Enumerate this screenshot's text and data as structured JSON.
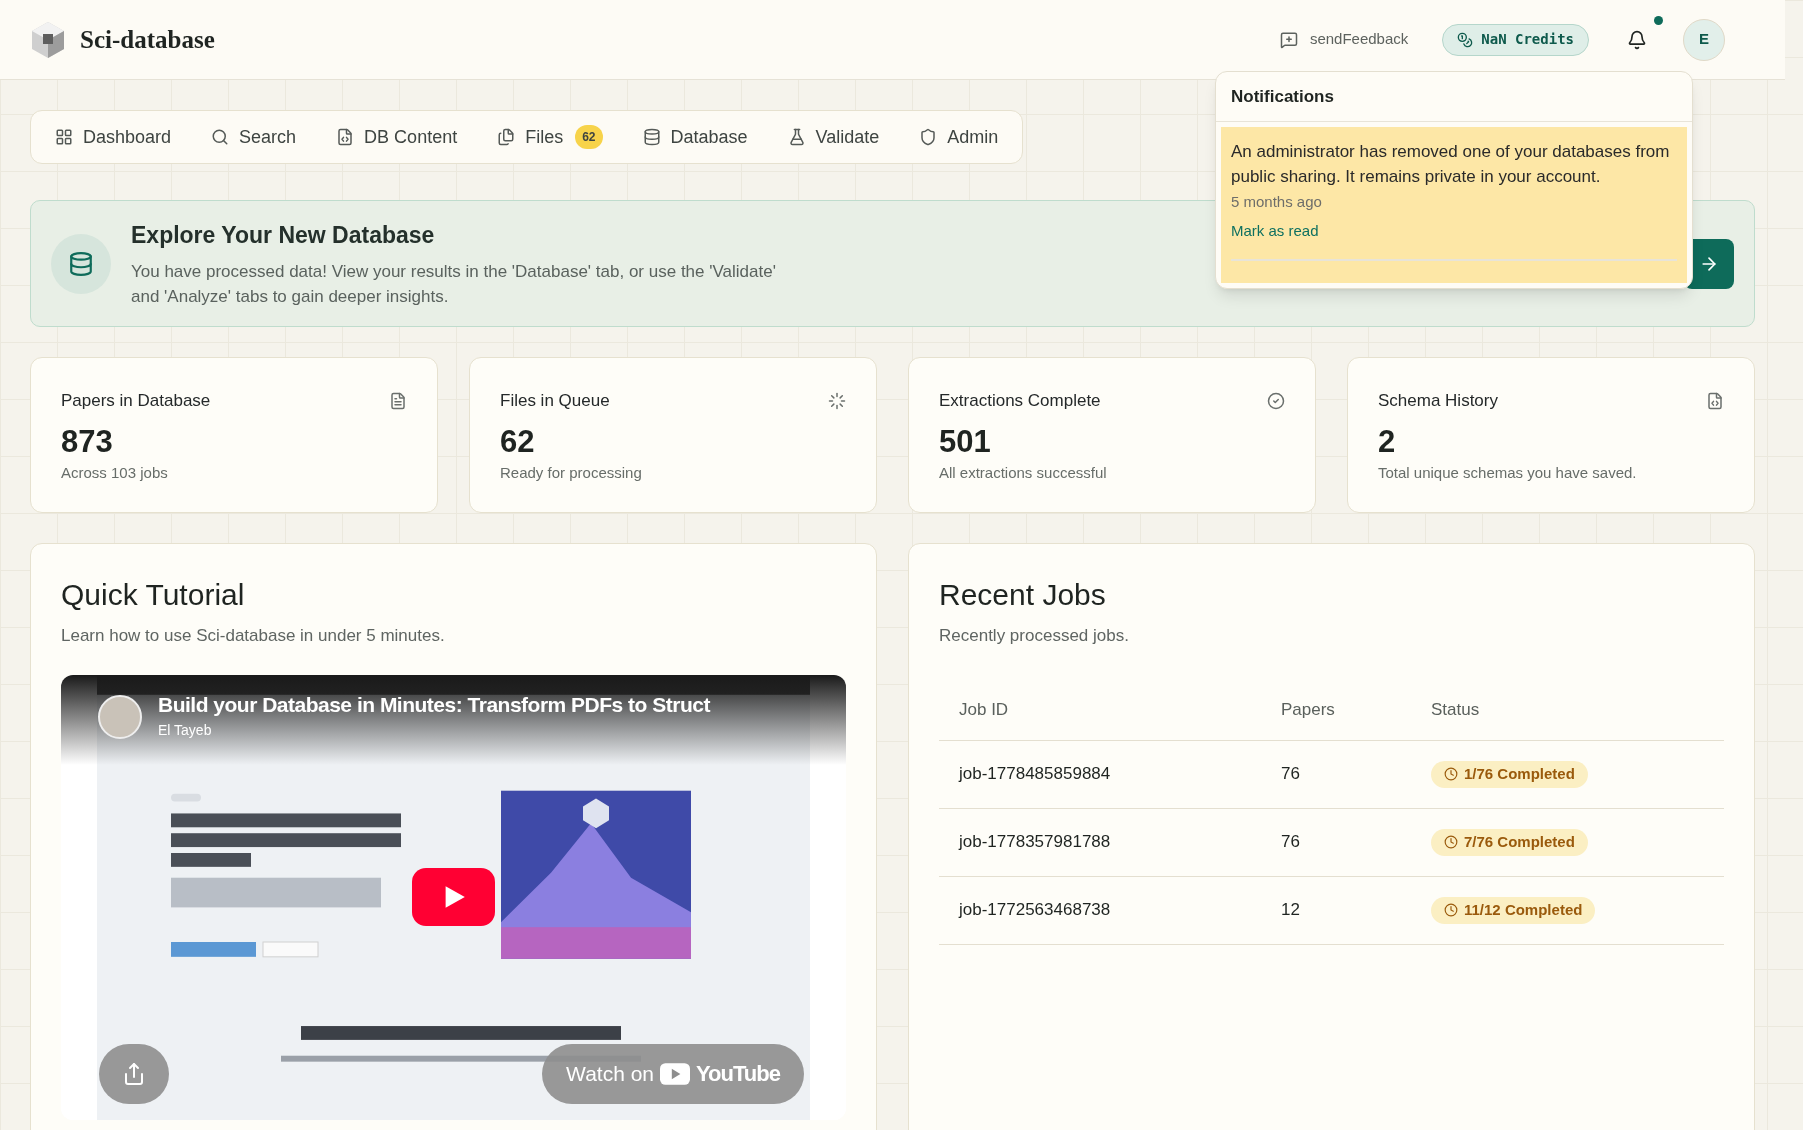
{
  "header": {
    "brand": "Sci-database",
    "feedback": "sendFeedback",
    "credits": "NaN Credits",
    "unread": true,
    "avatar": "E"
  },
  "nav": [
    {
      "label": "Dashboard"
    },
    {
      "label": "Search"
    },
    {
      "label": "DB Content"
    },
    {
      "label": "Files",
      "badge": "62"
    },
    {
      "label": "Database"
    },
    {
      "label": "Validate"
    },
    {
      "label": "Admin"
    }
  ],
  "banner": {
    "title": "Explore Your New Database",
    "text": "You have processed data! View your results in the 'Database' tab, or use the 'Validate' and 'Analyze' tabs to gain deeper insights."
  },
  "stats": [
    {
      "title": "Papers in Database",
      "value": "873",
      "note": "Across 103 jobs"
    },
    {
      "title": "Files in Queue",
      "value": "62",
      "note": "Ready for processing"
    },
    {
      "title": "Extractions Complete",
      "value": "501",
      "note": "All extractions successful"
    },
    {
      "title": "Schema History",
      "value": "2",
      "note": "Total unique schemas you have saved."
    }
  ],
  "tutorial": {
    "title": "Quick Tutorial",
    "subtitle": "Learn how to use Sci-database in under 5 minutes.",
    "video": {
      "kind": "picture",
      "title": "Build your Database in Minutes: Transform PDFs to Struct",
      "channel": "El Tayeb",
      "watch": "Watch on",
      "brand": "YouTube"
    }
  },
  "jobs": {
    "title": "Recent Jobs",
    "subtitle": "Recently processed jobs.",
    "columns": [
      "Job ID",
      "Papers",
      "Status"
    ],
    "rows": [
      {
        "id": "job-1778485859884",
        "papers": "76",
        "status": "1/76 Completed"
      },
      {
        "id": "job-1778357981788",
        "papers": "76",
        "status": "7/76 Completed"
      },
      {
        "id": "job-1772563468738",
        "papers": "12",
        "status": "11/12 Completed"
      }
    ]
  },
  "notifications": {
    "title": "Notifications",
    "items": [
      {
        "text": "An administrator has removed one of your databases from public sharing. It remains private in your account.",
        "time": "5 months ago",
        "action": "Mark as read",
        "read": false
      }
    ]
  }
}
